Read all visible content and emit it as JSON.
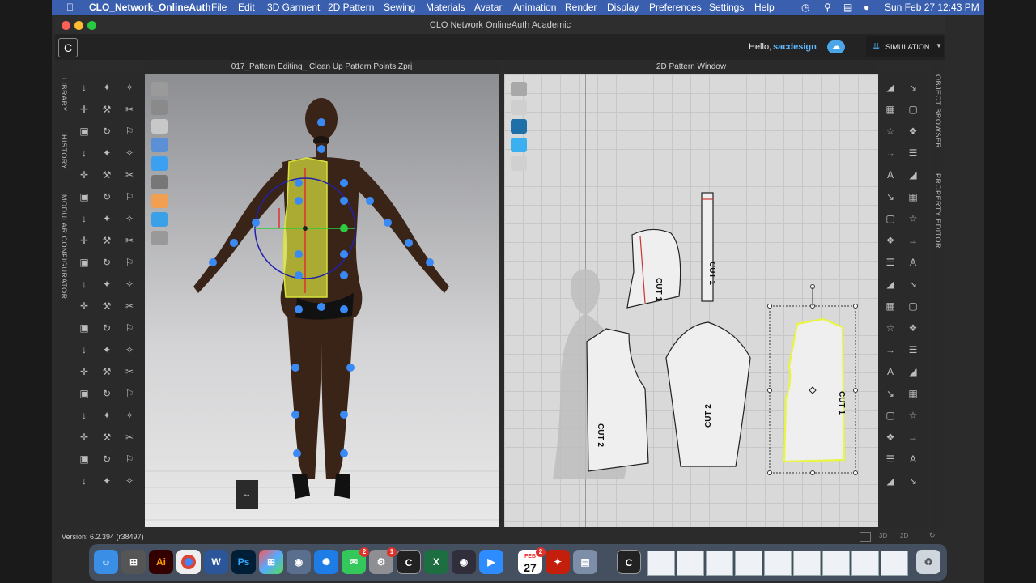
{
  "menubar": {
    "app_name": "CLO_Network_OnlineAuth",
    "items": [
      "File",
      "Edit",
      "3D Garment",
      "2D Pattern",
      "Sewing",
      "Materials",
      "Avatar",
      "Animation",
      "Render",
      "Display",
      "Preferences",
      "Settings",
      "Help"
    ],
    "clock": "Sun Feb 27  12:43 PM"
  },
  "window": {
    "title": "CLO Network OnlineAuth Academic"
  },
  "header": {
    "greeting": "Hello,",
    "username": "sacdesign",
    "mode_label": "SIMULATION"
  },
  "panel_3d": {
    "title": "017_Pattern Editing_ Clean Up Pattern Points.Zprj"
  },
  "panel_2d": {
    "title": "2D Pattern Window"
  },
  "left_tabs": [
    "LIBRARY",
    "HISTORY",
    "MODULAR CONFIGURATOR"
  ],
  "right_tabs": [
    "OBJECT BROWSER",
    "PROPERTY EDITOR"
  ],
  "patterns": {
    "hood": "CUT 1",
    "strip": "CUT 1",
    "front": "CUT 2",
    "sleeve": "CUT 2",
    "back": "CUT 1"
  },
  "status": {
    "version": "Version: 6.2.394 (r38497)"
  },
  "dock": {
    "illustrator": "Ai",
    "word": "W",
    "photoshop": "Ps",
    "excel": "X",
    "calendar_month": "FEB",
    "calendar_day": "27",
    "messages_badge": "2",
    "settings_badge": "1",
    "calendar_badge": "2"
  },
  "colors": {
    "accent": "#3a7bd5",
    "selection": "#e8f542",
    "menubar": "#3a5fae"
  }
}
